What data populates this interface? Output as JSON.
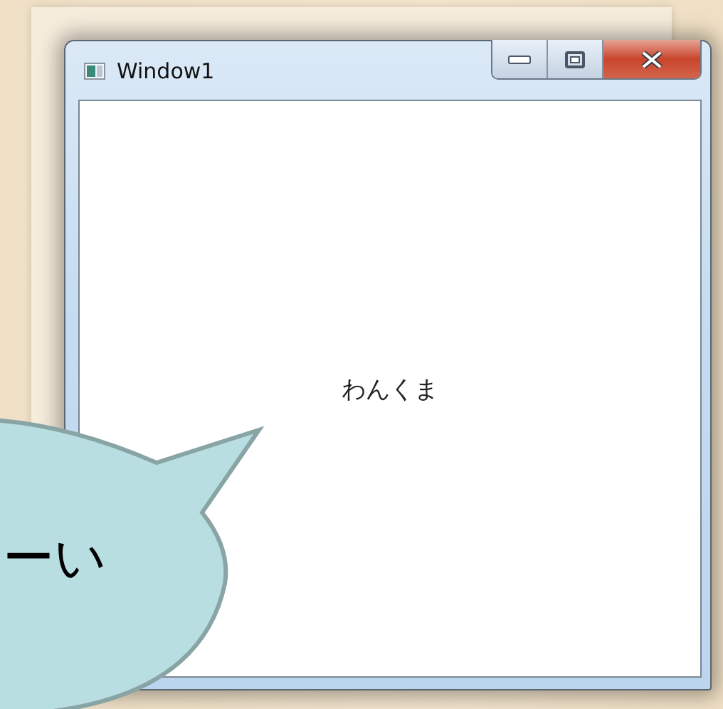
{
  "window": {
    "title": "Window1",
    "content_text": "わんくま"
  },
  "speech_bubble": {
    "text": "ーい"
  }
}
